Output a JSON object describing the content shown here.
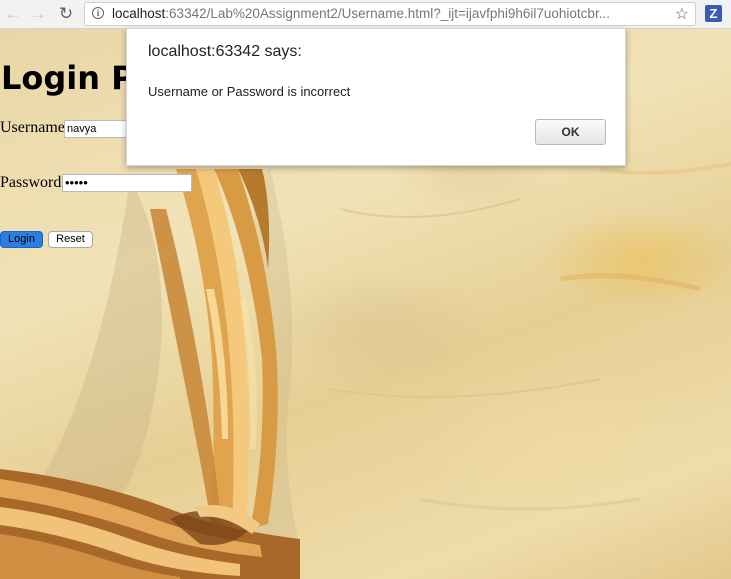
{
  "browser": {
    "back_icon": "back-arrow-icon",
    "forward_icon": "forward-arrow-icon",
    "reload_icon": "reload-icon",
    "url_host": "localhost",
    "url_rest": ":63342/Lab%20Assignment2/Username.html?_ijt=ijavfphi9h6il7uohiotcbr...",
    "bookmark_icon": "star-icon",
    "extension_label": "Z"
  },
  "page": {
    "title": "Login Page",
    "username_label": "Username",
    "username_value": "navya",
    "password_label": "Password",
    "password_mask": "•••••",
    "login_button": "Login",
    "reset_button": "Reset"
  },
  "dialog": {
    "title": "localhost:63342 says:",
    "message": "Username or Password is incorrect",
    "ok_label": "OK"
  },
  "colors": {
    "login_button": "#2a7de1",
    "extension_icon": "#3b5bb5",
    "background": "#e9d6a6"
  }
}
